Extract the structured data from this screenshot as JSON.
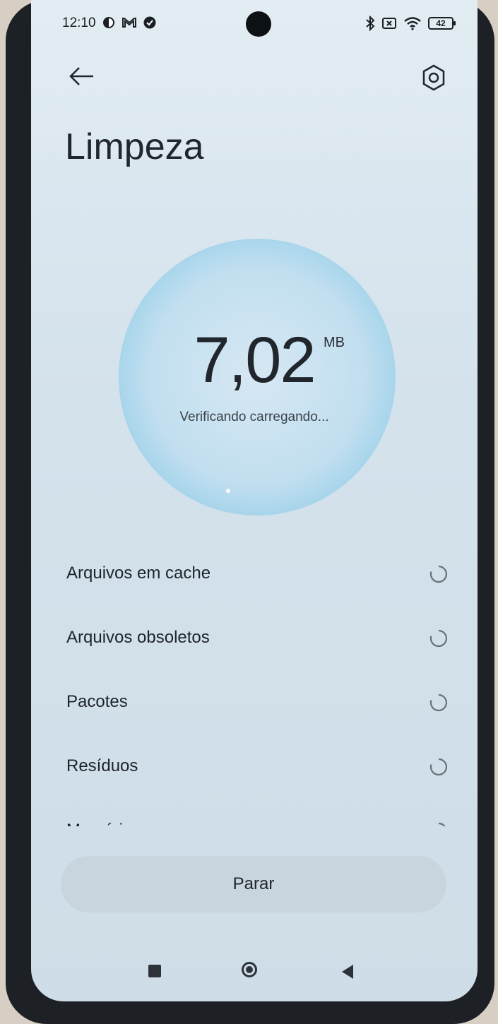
{
  "status_bar": {
    "time": "12:10",
    "battery": "42"
  },
  "header": {
    "title": "Limpeza"
  },
  "scan": {
    "size_value": "7,02",
    "size_unit": "MB",
    "status_text": "Verificando carregando..."
  },
  "categories": [
    {
      "label": "Arquivos em cache"
    },
    {
      "label": "Arquivos obsoletos"
    },
    {
      "label": "Pacotes"
    },
    {
      "label": "Resíduos"
    },
    {
      "label": "Memória"
    }
  ],
  "actions": {
    "stop_label": "Parar"
  },
  "colors": {
    "background": "#d8e4ee",
    "accent": "#7ec7e8",
    "text": "#20262c"
  }
}
